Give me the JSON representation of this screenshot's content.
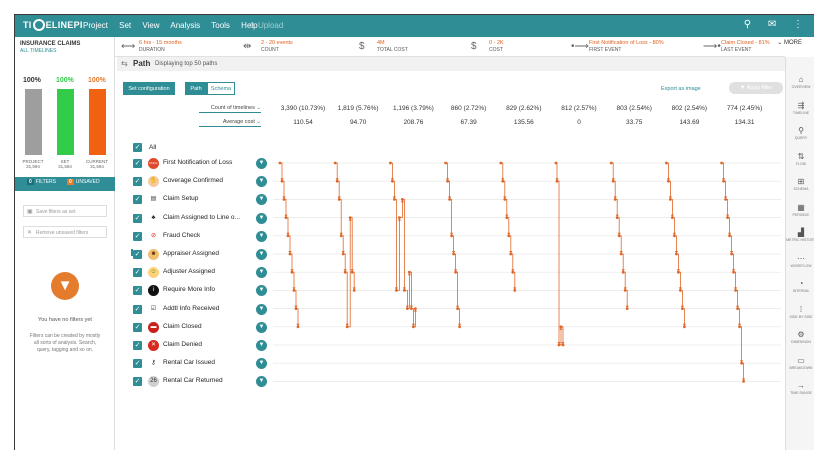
{
  "app": {
    "logo_text": "TIMELINEPI",
    "menu": [
      "Project",
      "Set",
      "View",
      "Analysis",
      "Tools",
      "Help"
    ],
    "upload_label": "Upload",
    "colors": {
      "teal": "#2f8d95",
      "orange": "#e57b2c",
      "green": "#33cc4a",
      "gray": "#9e9e9e"
    }
  },
  "stats": [
    {
      "icon": "duration-icon",
      "glyph": "⟷",
      "value": "6 hrs - 15 months",
      "label": "DURATION"
    },
    {
      "icon": "count-icon",
      "glyph": "⇹",
      "value": "2 - 20 events",
      "label": "COUNT"
    },
    {
      "icon": "dollar-icon",
      "glyph": "$",
      "value": "4M",
      "label": "TOTAL COST"
    },
    {
      "icon": "dollar-icon",
      "glyph": "$",
      "value": "0 - 2K",
      "label": "COST"
    },
    {
      "icon": "first-event-icon",
      "glyph": "•⟶",
      "value": "First Notification of Loss - 80%",
      "label": "FIRST EVENT"
    },
    {
      "icon": "last-event-icon",
      "glyph": "⟶•",
      "value": "Claim Closed - 81%",
      "label": "LAST EVENT"
    }
  ],
  "more_label": "MORE",
  "left": {
    "title": "INSURANCE CLAIMS",
    "subtitle": "ALL TIMELINES",
    "bars": [
      {
        "pct": "100%",
        "label": "PROJECT",
        "count": "31,594",
        "color": "#9e9e9e",
        "fill": 1.0
      },
      {
        "pct": "100%",
        "label": "SET",
        "count": "31,594",
        "color": "#33cc4a",
        "fill": 1.0
      },
      {
        "pct": "100%",
        "label": "CURRENT",
        "count": "31,594",
        "color": "#f0620f",
        "fill": 1.0
      }
    ],
    "filters_count": "0",
    "filters_label": "FILTERS",
    "unsaved_count": "0",
    "unsaved_label": "UNSAVED",
    "save_filters": "Save filters as set",
    "remove_filters": "Remove unsaved filters",
    "no_filters": "You have no filters yet",
    "no_filters_desc": "Filters can be created by mostly all sorts of analysis. Search, query, tagging and so on."
  },
  "main": {
    "title": "Path",
    "subtitle": "Displaying top 50 paths",
    "set_config": "Set configuration",
    "tab_path": "Path",
    "tab_schema": "Schema",
    "export": "Export as image",
    "apply_filter": "Apply filter",
    "count_select": "Count of timelines",
    "cost_select": "Average cost",
    "all_label": "All",
    "columns": [
      {
        "count": "3,390 (10.73%)",
        "cost": "110.54"
      },
      {
        "count": "1,819 (5.76%)",
        "cost": "94.70"
      },
      {
        "count": "1,196 (3.79%)",
        "cost": "208.76"
      },
      {
        "count": "860 (2.72%)",
        "cost": "67.39"
      },
      {
        "count": "829 (2.62%)",
        "cost": "135.56"
      },
      {
        "count": "812 (2.57%)",
        "cost": "0"
      },
      {
        "count": "803 (2.54%)",
        "cost": "33.75"
      },
      {
        "count": "802 (2.54%)",
        "cost": "143.69"
      },
      {
        "count": "774 (2.45%)",
        "cost": "134.31"
      }
    ],
    "events": [
      {
        "name": "First Notification of Loss",
        "icon": "fnol-icon",
        "glyph": "FNOL",
        "bg": "#e0492b",
        "fg": "#fff"
      },
      {
        "name": "Coverage Confirmed",
        "icon": "handshake-icon",
        "glyph": "✋",
        "bg": "#f4c99b",
        "fg": "#8a4a10"
      },
      {
        "name": "Claim Setup",
        "icon": "document-icon",
        "glyph": "▤",
        "bg": "#ffffff",
        "fg": "#333"
      },
      {
        "name": "Claim Assigned to Line o...",
        "icon": "team-icon",
        "glyph": "♣",
        "bg": "#ffffff",
        "fg": "#222"
      },
      {
        "name": "Fraud Check",
        "icon": "no-sign-icon",
        "glyph": "⊘",
        "bg": "#ffffff",
        "fg": "#d21"
      },
      {
        "name": "Appraiser Assigned",
        "icon": "appraiser-icon",
        "glyph": "☻",
        "bg": "#f0c070",
        "fg": "#6a3a10"
      },
      {
        "name": "Adjuster Assigned",
        "icon": "adjuster-icon",
        "glyph": "☺",
        "bg": "#ffd27a",
        "fg": "#3a7a20"
      },
      {
        "name": "Require More Info",
        "icon": "info-icon",
        "glyph": "i",
        "bg": "#111",
        "fg": "#fff"
      },
      {
        "name": "Addtl Info Received",
        "icon": "checklist-icon",
        "glyph": "☑",
        "bg": "#ffffff",
        "fg": "#333"
      },
      {
        "name": "Claim Closed",
        "icon": "closed-icon",
        "glyph": "▬",
        "bg": "#c8201a",
        "fg": "#fff"
      },
      {
        "name": "Claim Denied",
        "icon": "denied-icon",
        "glyph": "✕",
        "bg": "#d9281e",
        "fg": "#fff"
      },
      {
        "name": "Rental Car Issued",
        "icon": "key-icon",
        "glyph": "⚷",
        "bg": "#ffffff",
        "fg": "#222"
      },
      {
        "name": "Rental Car Returned",
        "icon": "returned-icon",
        "glyph": "26",
        "bg": "#d0d0d0",
        "fg": "#333"
      }
    ]
  },
  "rightbar": [
    {
      "icon": "overview-icon",
      "glyph": "⌂",
      "label": "OVERVIEW"
    },
    {
      "icon": "timeline-icon",
      "glyph": "⇶",
      "label": "TIMELINE"
    },
    {
      "icon": "query-icon",
      "glyph": "⚲",
      "label": "QUERY"
    },
    {
      "icon": "flow-icon",
      "glyph": "⇅",
      "label": "FLOW"
    },
    {
      "icon": "schema-icon",
      "glyph": "⊞",
      "label": "SCHEMA"
    },
    {
      "icon": "periodic-icon",
      "glyph": "▦",
      "label": "PERIODIC"
    },
    {
      "icon": "metric-history-icon",
      "glyph": "▟",
      "label": "METRIC HISTORY"
    },
    {
      "icon": "workflow-icon",
      "glyph": "⋯",
      "label": "WORKFLOW"
    },
    {
      "icon": "interval-icon",
      "glyph": "◔",
      "label": "INTERVAL"
    },
    {
      "icon": "sidebyside-icon",
      "glyph": "⁞",
      "label": "SIDE BY SIDE"
    },
    {
      "icon": "dimension-icon",
      "glyph": "⚙",
      "label": "DIMENSION"
    },
    {
      "icon": "breakdown-icon",
      "glyph": "▭",
      "label": "BREAKDOWN"
    },
    {
      "icon": "time-range-icon",
      "glyph": "→",
      "label": "TIME RANGE"
    }
  ]
}
